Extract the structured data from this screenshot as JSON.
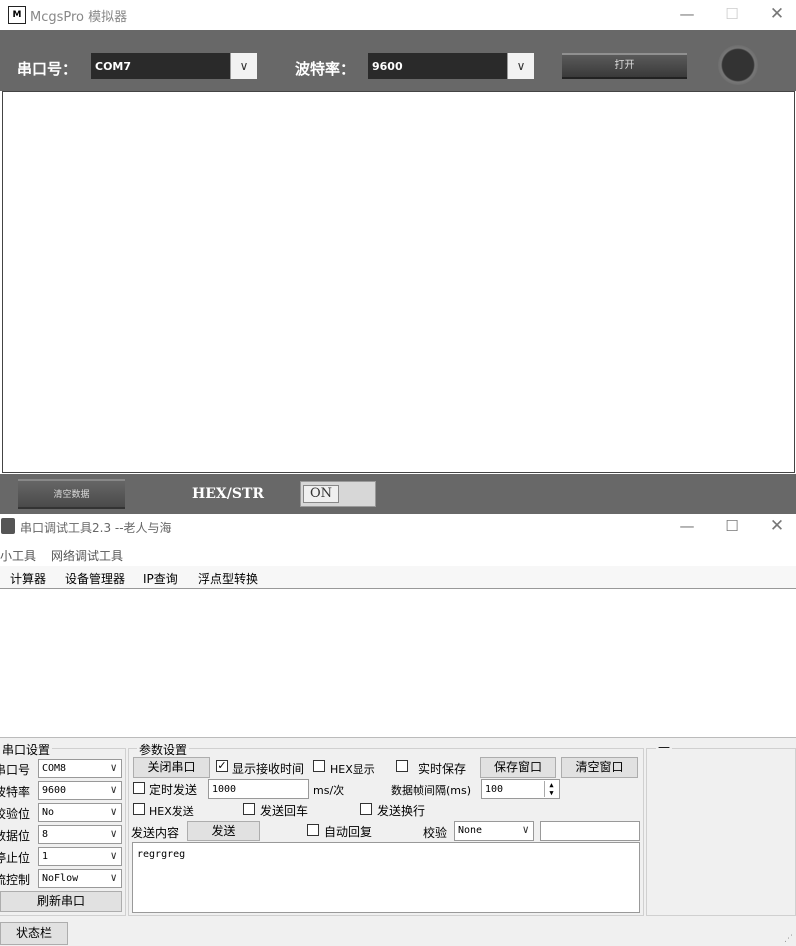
{
  "mcgs": {
    "title": "McgsPro 模拟器",
    "logo_text": "M",
    "port_label": "串口号：",
    "port_value": "COM7",
    "baud_label": "波特率：",
    "baud_value": "9600",
    "open_label": "打开",
    "clear_label": "清空数据",
    "hex_str_label": "HEX/STR",
    "toggle_label": "ON"
  },
  "serial_tool": {
    "title": "串口调试工具2.3 --老人与海",
    "tabs": [
      "小工具",
      "网络调试工具"
    ],
    "menu": [
      "计算器",
      "设备管理器",
      "IP查询",
      "浮点型转换"
    ],
    "port_settings": {
      "title": "串口设置",
      "port_label": "串口号",
      "port_value": "COM8",
      "baud_label": "波特率",
      "baud_value": "9600",
      "parity_label": "校验位",
      "parity_value": "No",
      "databits_label": "数据位",
      "databits_value": "8",
      "stopbits_label": "停止位",
      "stopbits_value": "1",
      "flow_label": "流控制",
      "flow_value": "NoFlow",
      "refresh_label": "刷新串口"
    },
    "params": {
      "title": "参数设置",
      "close_port": "关闭串口",
      "show_time": "显示接收时间",
      "hex_display": "HEX显示",
      "realtime_save": "实时保存",
      "save_window": "保存窗口",
      "clear_window": "清空窗口",
      "timed_send": "定时发送",
      "timed_value": "1000",
      "timed_unit": "ms/次",
      "frame_interval": "数据帧间隔(ms)",
      "frame_value": "100",
      "hex_send": "HEX发送",
      "send_echo": "发送回车",
      "send_newline": "发送换行",
      "send_content": "发送内容",
      "send_button": "发送",
      "auto_reply": "自动回复",
      "checksum_label": "校验",
      "checksum_value": "None",
      "send_text": "regrgreg"
    },
    "status_label": "状态栏",
    "extra_box_title": "—"
  }
}
